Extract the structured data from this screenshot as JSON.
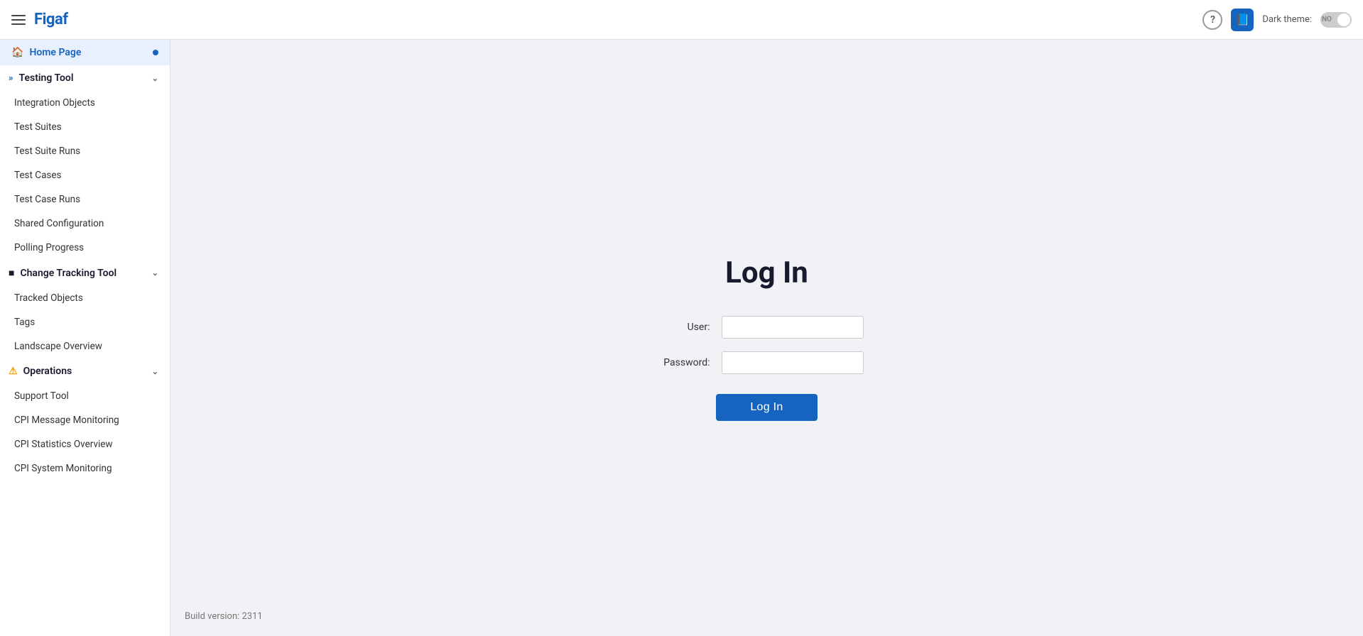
{
  "navbar": {
    "logo": "Figaf",
    "dark_theme_label": "Dark theme:",
    "toggle_state": "NO",
    "icons": {
      "hamburger": "hamburger-icon",
      "help": "?",
      "book": "📖"
    }
  },
  "sidebar": {
    "home_page": {
      "label": "Home Page",
      "active": true
    },
    "testing_tool": {
      "label": "Testing Tool",
      "items": [
        {
          "label": "Integration Objects"
        },
        {
          "label": "Test Suites"
        },
        {
          "label": "Test Suite Runs"
        },
        {
          "label": "Test Cases"
        },
        {
          "label": "Test Case Runs"
        },
        {
          "label": "Shared Configuration"
        },
        {
          "label": "Polling Progress"
        }
      ]
    },
    "change_tracking_tool": {
      "label": "Change Tracking Tool",
      "items": [
        {
          "label": "Tracked Objects"
        },
        {
          "label": "Tags"
        },
        {
          "label": "Landscape Overview"
        }
      ]
    },
    "operations": {
      "label": "Operations",
      "items": [
        {
          "label": "Support Tool"
        },
        {
          "label": "CPI Message Monitoring"
        },
        {
          "label": "CPI Statistics Overview"
        },
        {
          "label": "CPI System Monitoring"
        }
      ]
    }
  },
  "login": {
    "title": "Log In",
    "user_label": "User:",
    "password_label": "Password:",
    "user_placeholder": "",
    "password_placeholder": "",
    "button_label": "Log In"
  },
  "footer": {
    "build_version": "Build version: 2311"
  }
}
